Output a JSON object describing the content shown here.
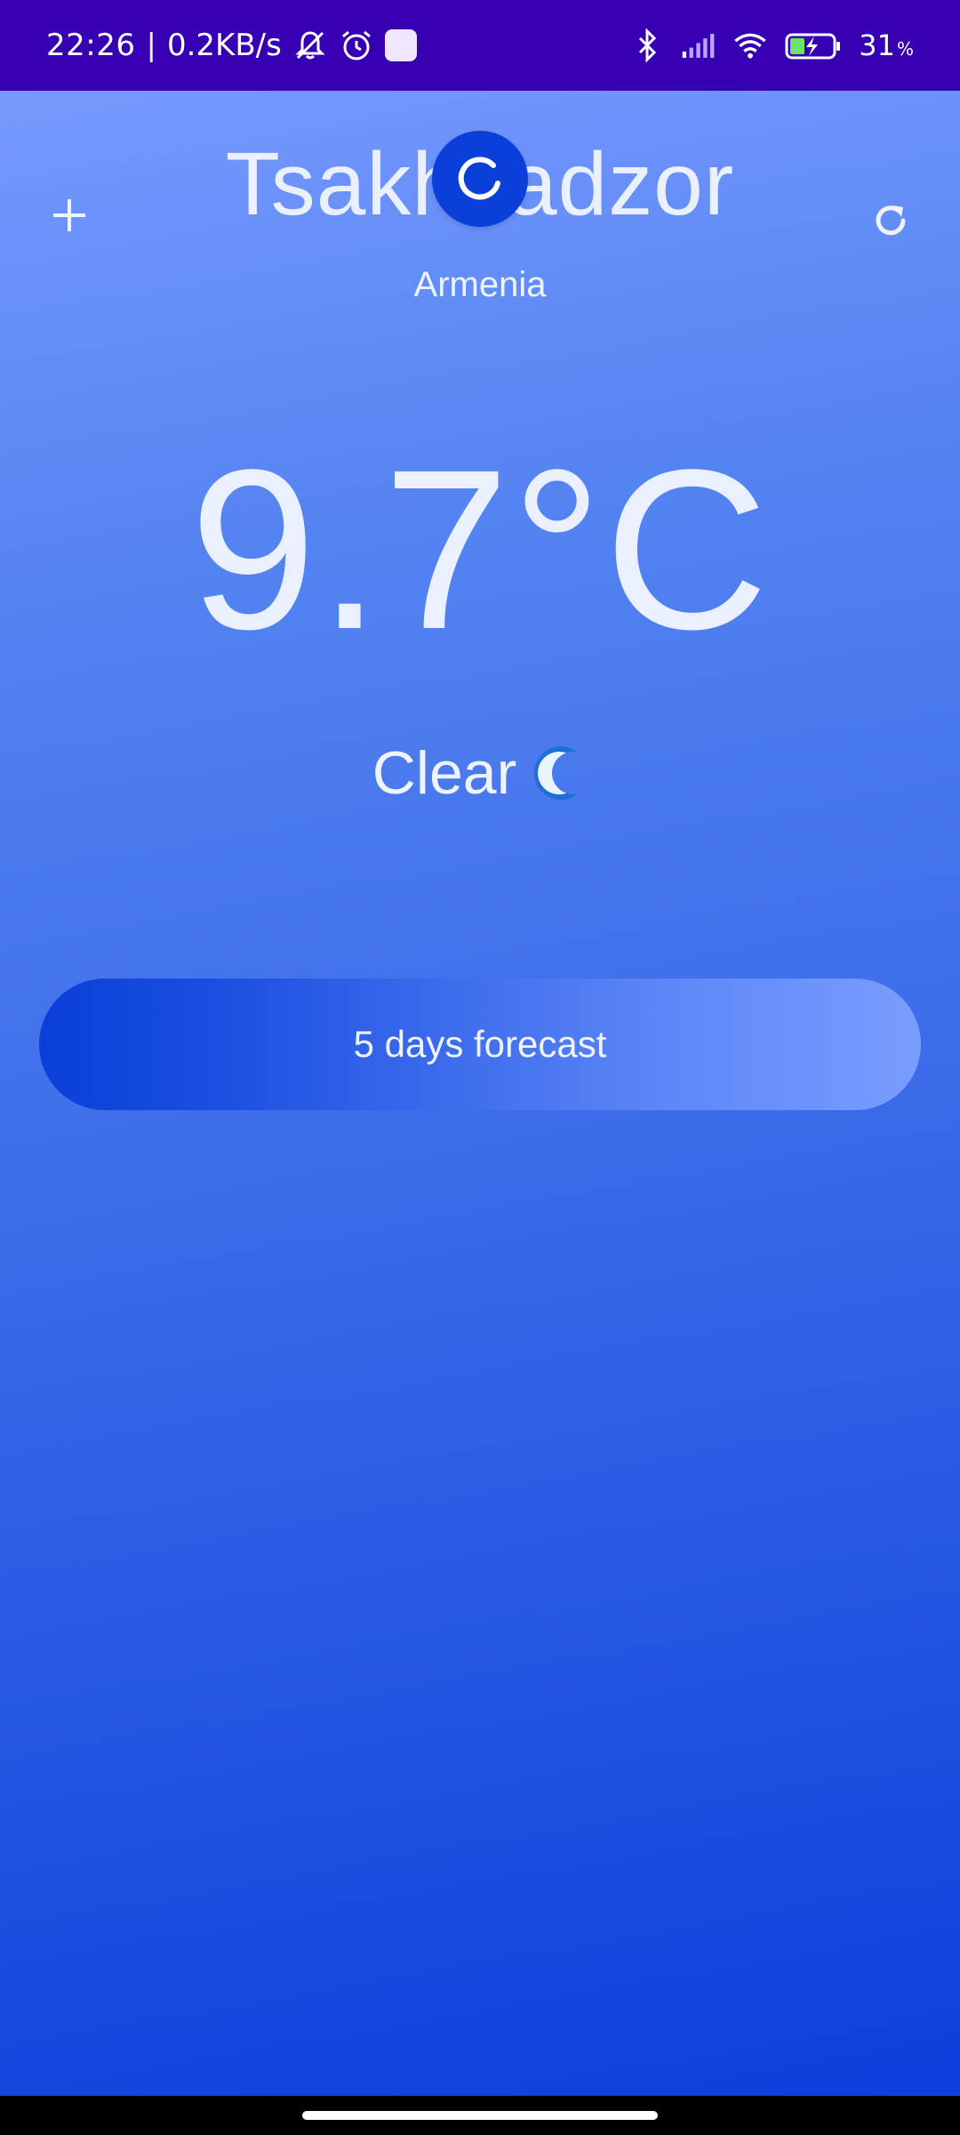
{
  "status_bar": {
    "time": "22:26",
    "separator": "|",
    "network_speed": "0.2KB/s",
    "icons": [
      "bell-muted-icon",
      "alarm-icon",
      "app-square-icon",
      "bluetooth-icon",
      "cell-signal-icon",
      "wifi-icon",
      "battery-charging-icon"
    ],
    "battery_value": "31",
    "battery_unit": "%",
    "background_color": "#3700b3"
  },
  "header": {
    "add_icon": "plus-icon",
    "refresh_icon": "refresh-icon",
    "city": "Tsakhkadzor",
    "country": "Armenia",
    "loading_icon": "spinner-icon"
  },
  "weather": {
    "temperature": "9.7°C",
    "condition": "Clear",
    "condition_icon": "crescent-moon-icon"
  },
  "forecast_button": {
    "label": "5 days forecast"
  },
  "colors": {
    "accent": "#0a3fd9",
    "gradient_top": "#7c9dff",
    "gradient_bottom": "#0a3ddb",
    "text": "#eaf0ff"
  }
}
